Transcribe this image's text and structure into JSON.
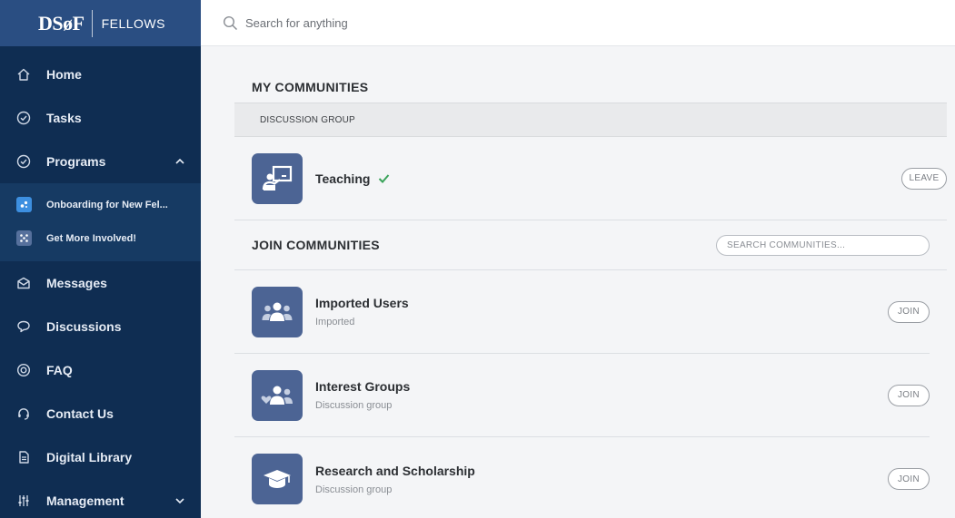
{
  "brand": {
    "logo": "DSøF",
    "sub": "FELLOWS"
  },
  "search": {
    "placeholder": "Search for anything"
  },
  "sidebar": {
    "items": [
      {
        "label": "Home",
        "icon": "home-icon"
      },
      {
        "label": "Tasks",
        "icon": "check-circle-icon"
      },
      {
        "label": "Programs",
        "icon": "check-circle-icon",
        "expanded": true
      },
      {
        "label": "Messages",
        "icon": "envelope-icon"
      },
      {
        "label": "Discussions",
        "icon": "chat-bubbles-icon"
      },
      {
        "label": "FAQ",
        "icon": "lifebuoy-icon"
      },
      {
        "label": "Contact Us",
        "icon": "headset-icon"
      },
      {
        "label": "Digital Library",
        "icon": "document-icon"
      },
      {
        "label": "Management",
        "icon": "sliders-icon"
      }
    ],
    "programs": [
      {
        "label": "Onboarding for New Fel...",
        "icon": "onboarding-icon"
      },
      {
        "label": "Get More Involved!",
        "icon": "network-icon"
      }
    ]
  },
  "my_communities": {
    "title": "MY COMMUNITIES",
    "group_header": "DISCUSSION GROUP",
    "items": [
      {
        "name": "Teaching",
        "verified": true,
        "action": "LEAVE",
        "icon": "teaching-icon"
      }
    ]
  },
  "join_communities": {
    "title": "JOIN COMMUNITIES",
    "search_placeholder": "SEARCH COMMUNITIES...",
    "items": [
      {
        "name": "Imported Users",
        "subtitle": "Imported",
        "action": "JOIN",
        "icon": "users-icon"
      },
      {
        "name": "Interest Groups",
        "subtitle": "Discussion group",
        "action": "JOIN",
        "icon": "interest-group-icon"
      },
      {
        "name": "Research and Scholarship",
        "subtitle": "Discussion group",
        "action": "JOIN",
        "icon": "graduation-cap-icon"
      }
    ]
  },
  "colors": {
    "sidebar_bg": "#0f2d52",
    "brand_bg": "#2a4e82",
    "tile_bg": "#4c6494",
    "check_green": "#3aa35a"
  }
}
